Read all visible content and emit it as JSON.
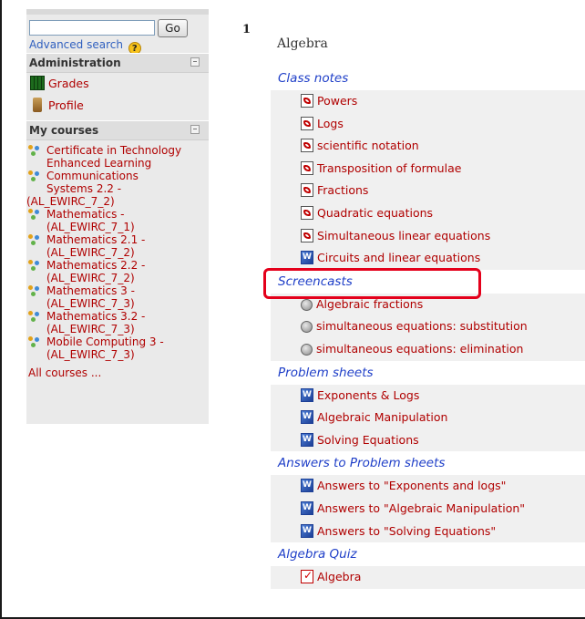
{
  "sidebar": {
    "search": {
      "value": "",
      "button_label": "Go",
      "advanced_label": "Advanced search",
      "help_symbol": "?"
    },
    "administration": {
      "title": "Administration",
      "items": [
        {
          "label": "Grades",
          "icon": "grades-icon"
        },
        {
          "label": "Profile",
          "icon": "profile-icon"
        }
      ]
    },
    "my_courses": {
      "title": "My courses",
      "items": [
        {
          "line1": "Certificate in Technology",
          "line2": "Enhanced Learning"
        },
        {
          "line1": "Communications",
          "line2": "Systems 2.2 -",
          "line3": "(AL_EWIRC_7_2)"
        },
        {
          "line1": "Mathematics -",
          "line2": "(AL_EWIRC_7_1)"
        },
        {
          "line1": "Mathematics 2.1 -",
          "line2": "(AL_EWIRC_7_2)"
        },
        {
          "line1": "Mathematics 2.2 -",
          "line2": "(AL_EWIRC_7_2)"
        },
        {
          "line1": "Mathematics 3 -",
          "line2": "(AL_EWIRC_7_3)"
        },
        {
          "line1": "Mathematics 3.2 -",
          "line2": "(AL_EWIRC_7_3)"
        },
        {
          "line1": "Mobile Computing 3 -",
          "line2": "(AL_EWIRC_7_3)"
        }
      ],
      "all_courses": "All courses ..."
    }
  },
  "main": {
    "section_number": "1",
    "section_title": "Algebra",
    "class_notes": {
      "label": "Class notes",
      "items": [
        "Powers",
        "Logs",
        "scientific notation",
        "Transposition of formulae",
        "Fractions",
        "Quadratic equations",
        "Simultaneous linear equations",
        "Circuits and linear equations"
      ]
    },
    "screencasts": {
      "label": "Screencasts",
      "items": [
        "Algebraic fractions",
        "simultaneous equations: substitution",
        "simultaneous equations: elimination"
      ]
    },
    "problem_sheets": {
      "label": "Problem sheets",
      "items": [
        "Exponents & Logs",
        "Algebraic Manipulation",
        "Solving Equations"
      ]
    },
    "answers": {
      "label": "Answers to Problem sheets",
      "items": [
        "Answers to \"Exponents and logs\"",
        "Answers to \"Algebraic Manipulation\"",
        "Answers to \"Solving Equations\""
      ]
    },
    "quiz": {
      "label": "Algebra Quiz",
      "items": [
        "Algebra"
      ]
    }
  },
  "colors": {
    "link_red": "#b00000",
    "label_blue": "#1f3fc8",
    "highlight": "#e4001b"
  }
}
